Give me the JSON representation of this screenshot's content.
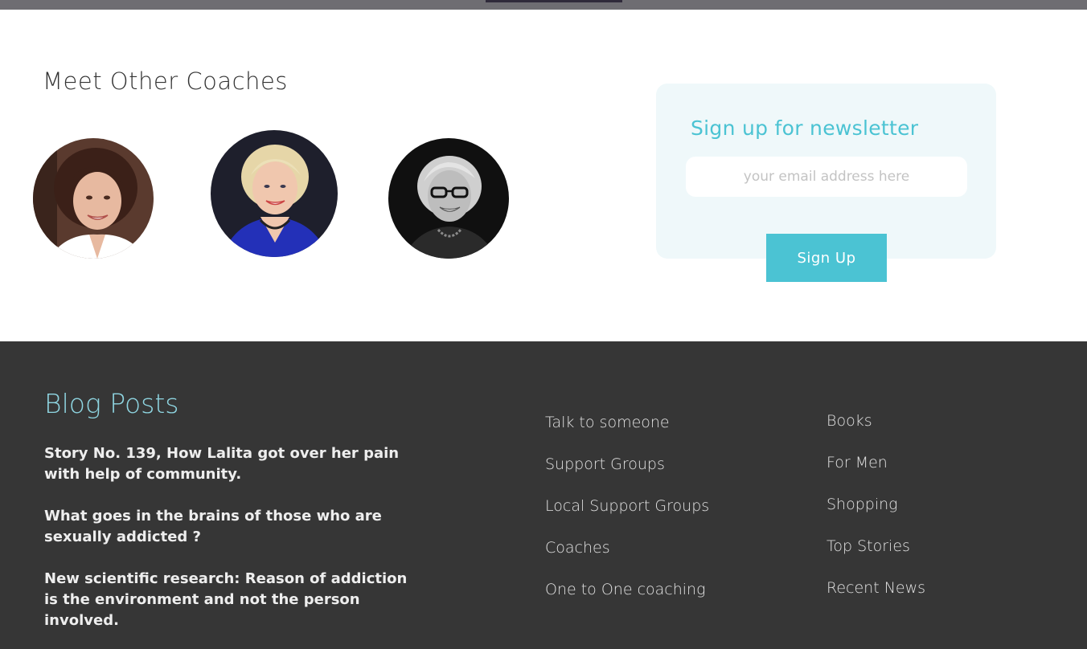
{
  "coaches_section": {
    "title": "Meet Other Coaches",
    "coaches": [
      {
        "photo": "coach-photo-1"
      },
      {
        "photo": "coach-photo-2"
      },
      {
        "photo": "coach-photo-3"
      }
    ]
  },
  "newsletter": {
    "title": "Sign up for newsletter",
    "email_placeholder": "your email address here",
    "email_value": "",
    "button_label": "Sign Up",
    "accent_color": "#4bc3d3"
  },
  "footer": {
    "blog_title": "Blog Posts",
    "blog_posts": [
      "Story No. 139, How Lalita got over her pain with help of community.",
      "What goes in the brains of those who are sexually addicted ?",
      "New scientific research: Reason of addiction is the environment and not the person involved."
    ],
    "links_col1": [
      "Talk to someone",
      "Support Groups",
      "Local Support Groups",
      "Coaches",
      "One to One coaching"
    ],
    "links_col2": [
      "Books",
      "For Men",
      "Shopping",
      "Top Stories",
      "Recent News"
    ],
    "background_color": "#363636"
  }
}
